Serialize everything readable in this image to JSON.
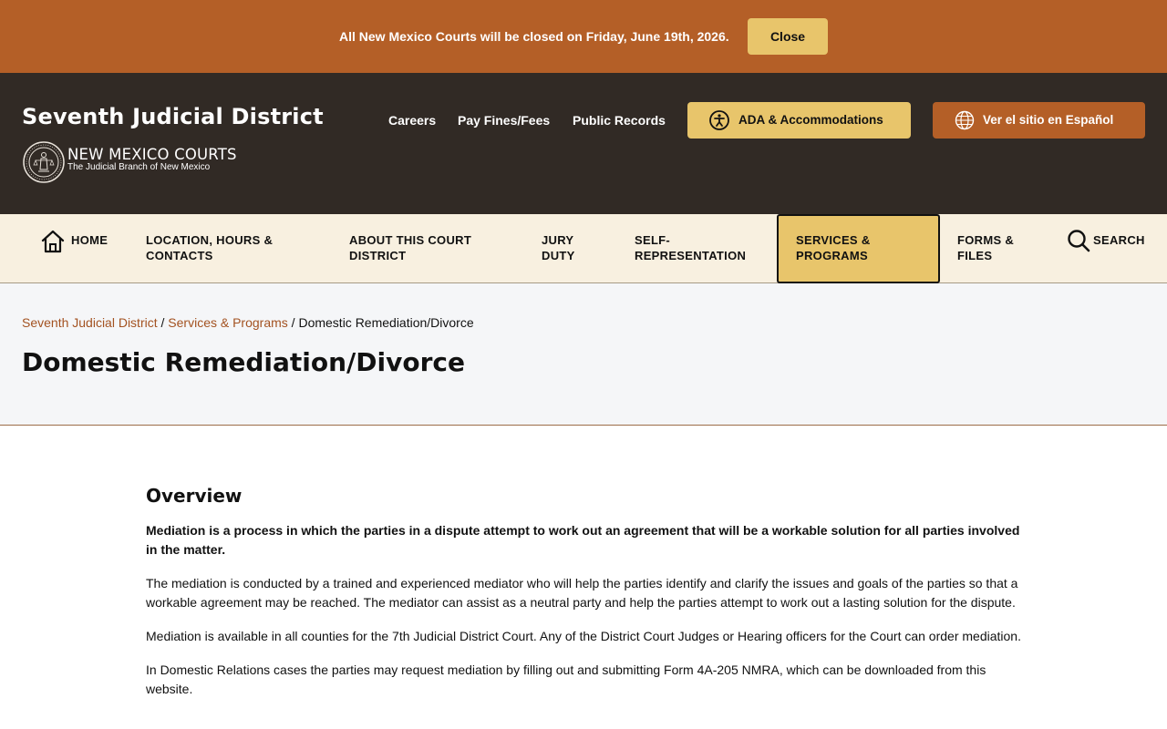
{
  "alert": {
    "message": "All New Mexico Courts will be closed on Friday, June 19th, 2026.",
    "close_label": "Close"
  },
  "header": {
    "site_title": "Seventh Judicial District",
    "logo_name": "NEW MEXICO COURTS",
    "logo_tagline": "The Judicial Branch of New Mexico",
    "links": [
      "Careers",
      "Pay Fines/Fees",
      "Public Records"
    ],
    "ada_label": "ADA & Accommodations",
    "spanish_label": "Ver el sitio en Español",
    "colors": {
      "header_bg": "#312a25",
      "accent": "#b45f27",
      "gold": "#e8c56b"
    }
  },
  "nav": {
    "items": [
      {
        "label": "HOME",
        "icon": "home-icon"
      },
      {
        "label": "LOCATION, HOURS & CONTACTS"
      },
      {
        "label": "ABOUT THIS COURT DISTRICT"
      },
      {
        "label": "JURY DUTY"
      },
      {
        "label": "SELF-REPRESENTATION"
      },
      {
        "label": "SERVICES & PROGRAMS",
        "active": true
      },
      {
        "label": "FORMS & FILES"
      },
      {
        "label": "SEARCH",
        "icon": "search-icon"
      }
    ]
  },
  "breadcrumb": {
    "items": [
      "Seventh Judicial District",
      "Services & Programs"
    ],
    "current": "Domestic Remediation/Divorce",
    "separator": "/"
  },
  "page": {
    "title": "Domestic Remediation/Divorce"
  },
  "content": {
    "heading": "Overview",
    "lead": "Mediation is a process in which the parties in a dispute attempt to work out an agreement that will be a workable solution for all parties involved in the matter.",
    "paragraphs": [
      "The mediation is conducted by a trained and experienced mediator who will help the parties identify and clarify the issues and goals of the parties so that a workable agreement may be reached. The mediator can assist as a neutral party and help the parties attempt to work out a lasting solution for the dispute.",
      "Mediation is available in all counties for the 7th Judicial District Court. Any of the District Court Judges or Hearing officers for the Court can order mediation.",
      "In Domestic Relations cases the parties may request mediation by filling out and submitting Form 4A-205 NMRA, which can be downloaded from this website."
    ]
  }
}
